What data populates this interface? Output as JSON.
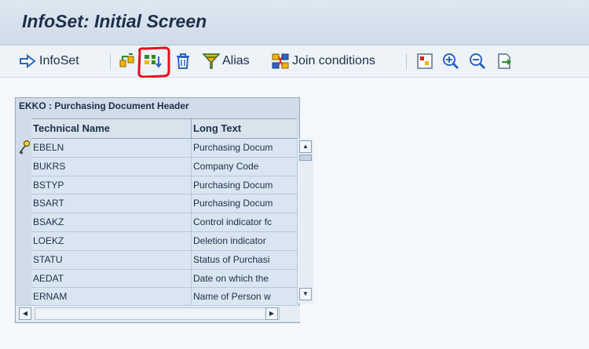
{
  "window": {
    "title": "InfoSet: Initial Screen"
  },
  "toolbar": {
    "infoset_label": "InfoSet",
    "alias_label": "Alias",
    "join_label": "Join conditions"
  },
  "table": {
    "title": "EKKO : Purchasing Document Header",
    "columns": [
      "Technical Name",
      "Long Text"
    ],
    "rows": [
      {
        "tech": "EBELN",
        "long": "Purchasing Docum",
        "key": true
      },
      {
        "tech": "BUKRS",
        "long": "Company Code"
      },
      {
        "tech": "BSTYP",
        "long": "Purchasing Docum"
      },
      {
        "tech": "BSART",
        "long": "Purchasing Docum"
      },
      {
        "tech": "BSAKZ",
        "long": "Control indicator fc"
      },
      {
        "tech": "LOEKZ",
        "long": "Deletion indicator"
      },
      {
        "tech": "STATU",
        "long": "Status of Purchasi"
      },
      {
        "tech": "AEDAT",
        "long": "Date on which the"
      },
      {
        "tech": "ERNAM",
        "long": "Name of Person w"
      }
    ]
  },
  "colors": {
    "highlight": "#e0121b",
    "title_text": "#1c2f4a"
  }
}
